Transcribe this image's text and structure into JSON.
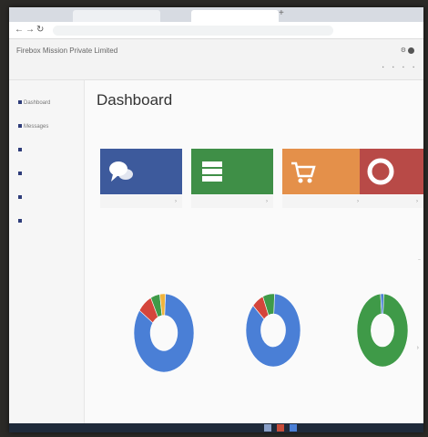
{
  "browser": {
    "tabs": [
      "",
      "",
      ""
    ],
    "url": ""
  },
  "app": {
    "title": "Firebox Mission Private Limited"
  },
  "sidebar": {
    "items": [
      {
        "label": "Dashboard"
      },
      {
        "label": "Messages"
      },
      {
        "label": ""
      },
      {
        "label": ""
      },
      {
        "label": ""
      },
      {
        "label": ""
      }
    ]
  },
  "page": {
    "title": "Dashboard"
  },
  "cards": [
    {
      "color": "#3d5a9c",
      "icon": "chat-bubbles-icon"
    },
    {
      "color": "#3f8f47",
      "icon": "server-icon"
    },
    {
      "color": "#e4904a",
      "icon": "cart-icon"
    },
    {
      "color": "#b84a47",
      "icon": "lifebuoy-icon"
    }
  ],
  "chart_data": [
    {
      "type": "pie",
      "style": "donut",
      "title": "",
      "slices": [
        {
          "label": "",
          "value": 84,
          "color": "#4a7fd6"
        },
        {
          "label": "",
          "value": 8,
          "color": "#d4453b"
        },
        {
          "label": "",
          "value": 5,
          "color": "#3f9a48"
        },
        {
          "label": "",
          "value": 3,
          "color": "#f0b43c"
        }
      ]
    },
    {
      "type": "pie",
      "style": "donut",
      "title": "",
      "slices": [
        {
          "label": "",
          "value": 86,
          "color": "#4a7fd6"
        },
        {
          "label": "",
          "value": 7,
          "color": "#d4453b"
        },
        {
          "label": "",
          "value": 7,
          "color": "#3f9a48"
        }
      ]
    },
    {
      "type": "pie",
      "style": "donut",
      "title": "",
      "slices": [
        {
          "label": "",
          "value": 98,
          "color": "#3f9a48"
        },
        {
          "label": "",
          "value": 2,
          "color": "#4a7fd6"
        }
      ]
    }
  ]
}
